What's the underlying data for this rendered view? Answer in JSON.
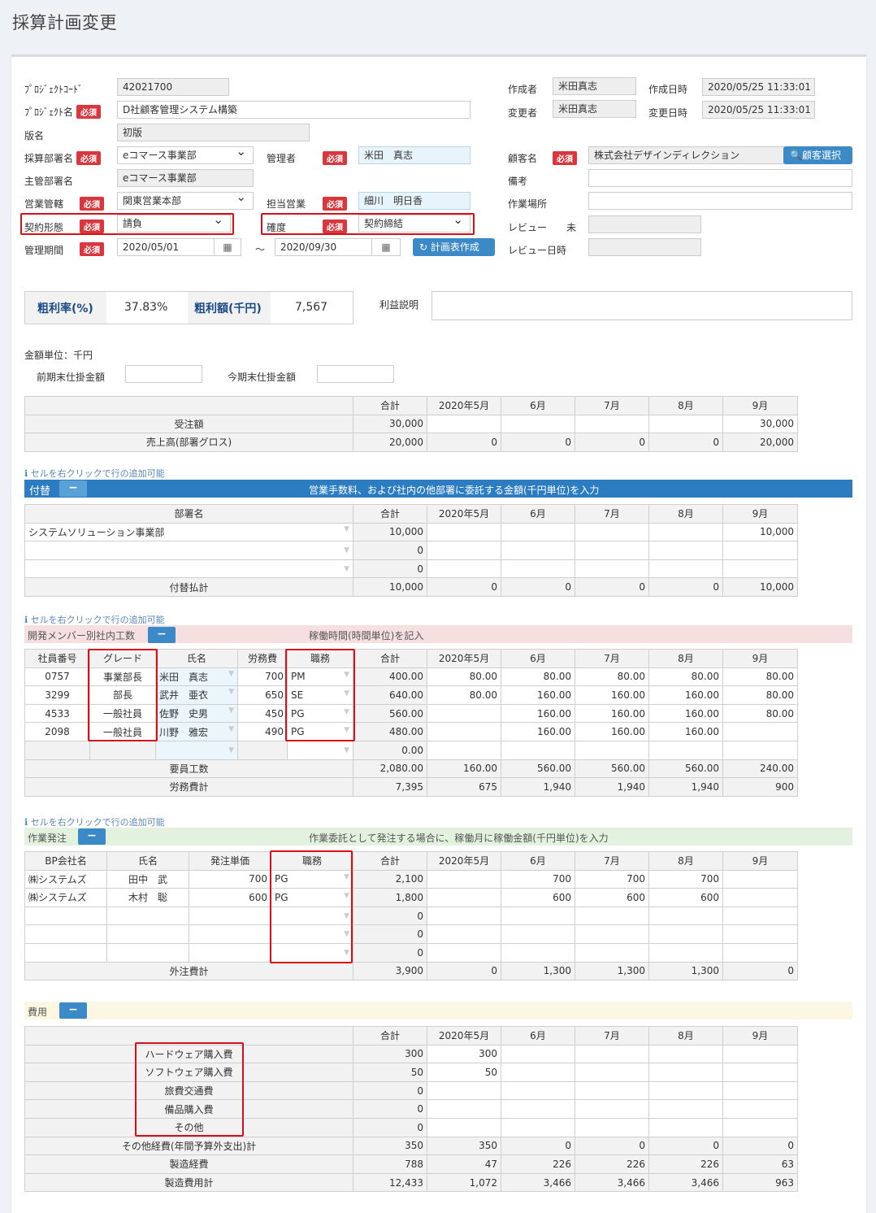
{
  "title": "採算計画変更",
  "form": {
    "project_code_label": "ﾌﾟﾛｼﾞｪｸﾄｺｰﾄﾞ",
    "project_code": "42021700",
    "project_name_label": "ﾌﾟﾛｼﾞｪｸﾄ名",
    "project_name": "D社顧客管理システム構築",
    "version_label": "版名",
    "version": "初版",
    "sales_dept_label": "採算部署名",
    "sales_dept": "eコマース事業部",
    "manager_label": "管理者",
    "manager": "米田　真志",
    "main_dept_label": "主管部署名",
    "main_dept": "eコマース事業部",
    "business_label": "営業管轄",
    "business": "関東営業本部",
    "sales_rep_label": "担当営業",
    "sales_rep": "細川　明日香",
    "contract_label": "契約形態",
    "contract": "請負",
    "certainty_label": "確度",
    "certainty": "契約締結",
    "period_label": "管理期間",
    "period_from": "2020/05/01",
    "period_sep": "～",
    "period_to": "2020/09/30",
    "plan_button": "計画表作成",
    "creator_label": "作成者",
    "creator": "米田真志",
    "created_label": "作成日時",
    "created": "2020/05/25 11:33:01",
    "modifier_label": "変更者",
    "modifier": "米田真志",
    "modified_label": "変更日時",
    "modified": "2020/05/25 11:33:01",
    "customer_label": "顧客名",
    "customer": "株式会社デザインディレクション",
    "customer_button": "顧客選択",
    "note_label": "備考",
    "workplace_label": "作業場所",
    "review_label": "レビュー",
    "review_status": "未",
    "review_date_label": "レビュー日時",
    "required": "必須"
  },
  "profit": {
    "rate_label": "粗利率(%)",
    "rate": "37.83%",
    "amount_label": "粗利額(千円)",
    "amount": "7,567",
    "desc_label": "利益説明"
  },
  "unit": {
    "label": "金額単位：千円",
    "prev_label": "前期末仕掛金額",
    "curr_label": "今期末仕掛金額"
  },
  "months": [
    "合計",
    "2020年5月",
    "6月",
    "7月",
    "8月",
    "9月"
  ],
  "hint": "セルを右クリックで行の追加可能",
  "summary": {
    "rows": [
      {
        "label": "受注額",
        "vals": [
          "30,000",
          "",
          "",
          "",
          "",
          "30,000"
        ]
      },
      {
        "label": "売上高(部署グロス)",
        "vals": [
          "20,000",
          "0",
          "0",
          "0",
          "0",
          "20,000"
        ]
      }
    ]
  },
  "transfer": {
    "title": "付替",
    "desc": "営業手数料、および社内の他部署に委託する金額(千円単位)を入力",
    "col": "部署名",
    "rows": [
      {
        "name": "システムソリューション事業部",
        "vals": [
          "10,000",
          "",
          "",
          "",
          "",
          "10,000"
        ]
      },
      {
        "name": "",
        "vals": [
          "0",
          "",
          "",
          "",
          "",
          ""
        ]
      },
      {
        "name": "",
        "vals": [
          "0",
          "",
          "",
          "",
          "",
          ""
        ]
      }
    ],
    "total": {
      "label": "付替払計",
      "vals": [
        "10,000",
        "0",
        "0",
        "0",
        "0",
        "10,000"
      ]
    }
  },
  "members": {
    "title": "開発メンバー別社内工数",
    "desc": "稼働時間(時間単位)を記入",
    "cols": [
      "社員番号",
      "グレード",
      "氏名",
      "労務費",
      "職務"
    ],
    "rows": [
      {
        "no": "0757",
        "grade": "事業部長",
        "name": "米田　真志",
        "cost": "700",
        "role": "PM",
        "vals": [
          "400.00",
          "80.00",
          "80.00",
          "80.00",
          "80.00",
          "80.00"
        ]
      },
      {
        "no": "3299",
        "grade": "部長",
        "name": "武井　亜衣",
        "cost": "650",
        "role": "SE",
        "vals": [
          "640.00",
          "80.00",
          "160.00",
          "160.00",
          "160.00",
          "80.00"
        ]
      },
      {
        "no": "4533",
        "grade": "一般社員",
        "name": "佐野　史男",
        "cost": "450",
        "role": "PG",
        "vals": [
          "560.00",
          "",
          "160.00",
          "160.00",
          "160.00",
          "80.00"
        ]
      },
      {
        "no": "2098",
        "grade": "一般社員",
        "name": "川野　雅宏",
        "cost": "490",
        "role": "PG",
        "vals": [
          "480.00",
          "",
          "160.00",
          "160.00",
          "160.00",
          ""
        ]
      },
      {
        "no": "",
        "grade": "",
        "name": "",
        "cost": "",
        "role": "",
        "vals": [
          "0.00",
          "",
          "",
          "",
          "",
          ""
        ]
      }
    ],
    "total1": {
      "label": "要員工数",
      "vals": [
        "2,080.00",
        "160.00",
        "560.00",
        "560.00",
        "560.00",
        "240.00"
      ]
    },
    "total2": {
      "label": "労務費計",
      "vals": [
        "7,395",
        "675",
        "1,940",
        "1,940",
        "1,940",
        "900"
      ]
    }
  },
  "outsource": {
    "title": "作業発注",
    "desc": "作業委託として発注する場合に、稼働月に稼働金額(千円単位)を入力",
    "cols": [
      "BP会社名",
      "氏名",
      "発注単価",
      "職務"
    ],
    "rows": [
      {
        "company": "㈱システムズ",
        "name": "田中　武",
        "price": "700",
        "role": "PG",
        "vals": [
          "2,100",
          "",
          "700",
          "700",
          "700",
          ""
        ]
      },
      {
        "company": "㈱システムズ",
        "name": "木村　聡",
        "price": "600",
        "role": "PG",
        "vals": [
          "1,800",
          "",
          "600",
          "600",
          "600",
          ""
        ]
      },
      {
        "company": "",
        "name": "",
        "price": "",
        "role": "",
        "vals": [
          "0",
          "",
          "",
          "",
          "",
          ""
        ]
      },
      {
        "company": "",
        "name": "",
        "price": "",
        "role": "",
        "vals": [
          "0",
          "",
          "",
          "",
          "",
          ""
        ]
      },
      {
        "company": "",
        "name": "",
        "price": "",
        "role": "",
        "vals": [
          "0",
          "",
          "",
          "",
          "",
          ""
        ]
      }
    ],
    "total": {
      "label": "外注費計",
      "vals": [
        "3,900",
        "0",
        "1,300",
        "1,300",
        "1,300",
        "0"
      ]
    }
  },
  "expense": {
    "title": "費用",
    "rows": [
      {
        "label": "ハードウェア購入費",
        "vals": [
          "300",
          "300",
          "",
          "",
          "",
          ""
        ]
      },
      {
        "label": "ソフトウェア購入費",
        "vals": [
          "50",
          "50",
          "",
          "",
          "",
          ""
        ]
      },
      {
        "label": "旅費交通費",
        "vals": [
          "0",
          "",
          "",
          "",
          "",
          ""
        ]
      },
      {
        "label": "備品購入費",
        "vals": [
          "0",
          "",
          "",
          "",
          "",
          ""
        ]
      },
      {
        "label": "その他",
        "vals": [
          "0",
          "",
          "",
          "",
          "",
          ""
        ]
      }
    ],
    "totals": [
      {
        "label": "その他経費(年間予算外支出)計",
        "vals": [
          "350",
          "350",
          "0",
          "0",
          "0",
          "0"
        ]
      },
      {
        "label": "製造経費",
        "vals": [
          "788",
          "47",
          "226",
          "226",
          "226",
          "63"
        ]
      },
      {
        "label": "製造費用計",
        "vals": [
          "12,433",
          "1,072",
          "3,466",
          "3,466",
          "3,466",
          "963"
        ]
      }
    ]
  }
}
